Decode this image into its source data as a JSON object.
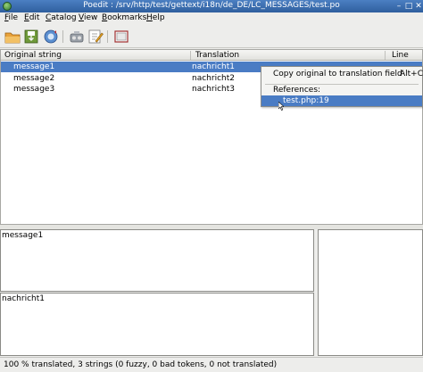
{
  "window": {
    "title": "Poedit : /srv/http/test/gettext/i18n/de_DE/LC_MESSAGES/test.po"
  },
  "menu": {
    "items": [
      {
        "label": "File",
        "mnemonic": "F",
        "rest": "ile"
      },
      {
        "label": "Edit",
        "mnemonic": "E",
        "rest": "dit"
      },
      {
        "label": "Catalog",
        "mnemonic": "C",
        "rest": "atalog"
      },
      {
        "label": "View",
        "mnemonic": "V",
        "rest": "iew"
      },
      {
        "label": "Bookmarks",
        "mnemonic": "B",
        "rest": "ookmarks"
      },
      {
        "label": "Help",
        "mnemonic": "H",
        "rest": "elp"
      }
    ]
  },
  "toolbar": {
    "icons": [
      "open-folder-icon",
      "save-icon",
      "update-catalog-icon",
      "validate-icon",
      "edit-comment-icon",
      "fullscreen-icon"
    ]
  },
  "list": {
    "columns": {
      "original": "Original string",
      "translation": "Translation",
      "line": "Line"
    },
    "rows": [
      {
        "original": "message1",
        "translation": "nachricht1",
        "selected": true
      },
      {
        "original": "message2",
        "translation": "nachricht2",
        "selected": false
      },
      {
        "original": "message3",
        "translation": "nachricht3",
        "selected": false
      }
    ]
  },
  "context_menu": {
    "copy_label": "Copy original to translation field",
    "copy_shortcut": "Alt+C",
    "references_label": "References:",
    "reference_item": "test.php:19"
  },
  "editor": {
    "original_text": "message1",
    "translation_text": "nachricht1"
  },
  "status": {
    "text": "100 % translated, 3 strings (0 fuzzy, 0 bad tokens, 0 not translated)"
  },
  "colors": {
    "selection": "#4a7cc4",
    "titlebar": "#3a6cb0"
  }
}
